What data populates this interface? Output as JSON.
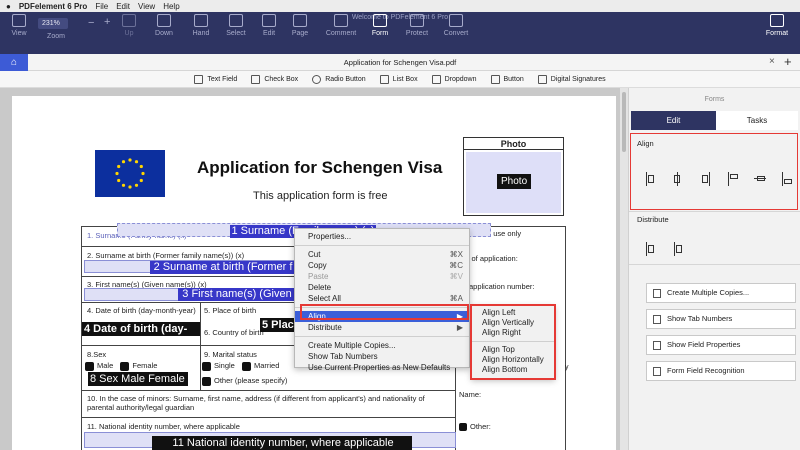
{
  "menubar": {
    "app": "PDFelement 6 Pro",
    "items": [
      "File",
      "Edit",
      "View",
      "Help"
    ]
  },
  "window_title": "Welcome to PDFelement 6 Pro",
  "toolbar": {
    "view": "View",
    "zoom_value": "231%",
    "zoom": "Zoom",
    "up": "Up",
    "down": "Down",
    "hand": "Hand",
    "select": "Select",
    "edit": "Edit",
    "page": "Page",
    "comment": "Comment",
    "form": "Form",
    "protect": "Protect",
    "convert": "Convert",
    "format": "Format"
  },
  "tab": {
    "title": "Application for Schengen Visa.pdf"
  },
  "formbar": {
    "items": [
      "Text Field",
      "Check Box",
      "Radio Button",
      "List Box",
      "Dropdown",
      "Button",
      "Digital Signatures"
    ]
  },
  "document": {
    "title": "Application for Schengen Visa",
    "subtitle": "This application form is free",
    "photo_label": "Photo",
    "photo_button": "Photo",
    "f1_label": "1. Surname (Family name) (x)",
    "f1_field": "1 Surname (Family name) (x)",
    "f2_label": "2. Surname at birth (Former family name(s)) (x)",
    "f2_field": "2 Surname at birth (Former f",
    "f3_label": "3. First name(s) (Given name(s)) (x)",
    "f3_field": "3 First name(s) (Given",
    "f4_label": "4. Date of birth (day-month-year)",
    "f4_field": "4 Date of birth (day-",
    "f5_label": "5. Place of birth",
    "f5_field": "5 Plac",
    "f6_label": "6. Country of birth",
    "f8_label": "8.Sex",
    "male": "Male",
    "female": "Female",
    "f8_field": "8 Sex Male Female",
    "f9_label": "9. Marital status",
    "single": "Single",
    "married": "Married",
    "other": "Other (please specify)",
    "f10_label": "10. In the case of minors: Surname, first name, address (if different from applicant's) and nationality of parental authority/legal guardian",
    "f11_label": "11. National identity number, where applicable",
    "f11_field": "11 National identity number, where applicable",
    "official": "official use only",
    "date_app": "ate of application:",
    "visa_num": "sa application number:",
    "name": "Name:",
    "other2": "Other:"
  },
  "context_menu": {
    "properties": "Properties...",
    "cut": "Cut",
    "cut_sc": "⌘X",
    "copy": "Copy",
    "copy_sc": "⌘C",
    "paste": "Paste",
    "paste_sc": "⌘V",
    "delete": "Delete",
    "select_all": "Select All",
    "select_all_sc": "⌘A",
    "align": "Align",
    "distribute": "Distribute",
    "create_copies": "Create Multiple Copies...",
    "show_tab": "Show Tab Numbers",
    "use_current": "Use Current Properties as New Defaults"
  },
  "align_submenu": {
    "left": "Align Left",
    "vertically": "Align Vertically",
    "right": "Align Right",
    "top": "Align Top",
    "horizontally": "Align Horizontally",
    "bottom": "Align Bottom"
  },
  "panel": {
    "title": "Forms",
    "tab_edit": "Edit",
    "tab_tasks": "Tasks",
    "align": "Align",
    "distribute": "Distribute",
    "btn_copies": "Create Multiple Copies...",
    "btn_tab": "Show Tab Numbers",
    "btn_props": "Show Field Properties",
    "btn_recog": "Form Field Recognition"
  },
  "colors": {
    "toolbar": "#2e3462",
    "accent": "#3d5bd6",
    "highlight": "#e53935",
    "menu_selected": "#3b5fd9"
  }
}
